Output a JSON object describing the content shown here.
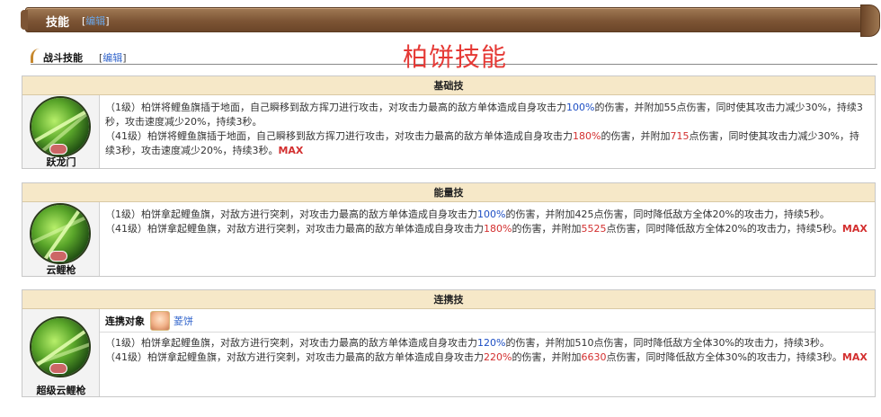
{
  "banner": {
    "title": "技能",
    "edit_open": "[",
    "edit_label": "编辑",
    "edit_close": "]"
  },
  "subhead": {
    "title": "战斗技能",
    "edit_open": "[",
    "edit_label": "编辑",
    "edit_close": "]"
  },
  "page_title": "柏饼技能",
  "skills": [
    {
      "section": "基础技",
      "name": "跃龙门",
      "level1": {
        "pre": "（1级）柏饼将鲤鱼旗插于地面，自己瞬移到敌方挥刀进行攻击，对攻击力最高的敌方单体造成自身攻击力",
        "pct": "100%",
        "mid": "的伤害，并附加55点伤害，同时使其攻击力减少30%，持续3秒，攻击速度减少20%，持续3秒。"
      },
      "level41": {
        "pre": "（41级）柏饼将鲤鱼旗插于地面，自己瞬移到敌方挥刀进行攻击，对攻击力最高的敌方单体造成自身攻击力",
        "pct": "180%",
        "mid": "的伤害，并附加",
        "num": "715",
        "post": "点伤害，同时使其攻击力减少30%，持续3秒，攻击速度减少20%，持续3秒。",
        "max": "MAX"
      }
    },
    {
      "section": "能量技",
      "name": "云鲤枪",
      "level1": {
        "pre": "（1级）柏饼拿起鲤鱼旗，对敌方进行突刺，对攻击力最高的敌方单体造成自身攻击力",
        "pct": "100%",
        "mid": "的伤害，并附加425点伤害，同时降低敌方全体20%的攻击力，持续5秒。"
      },
      "level41": {
        "pre": "（41级）柏饼拿起鲤鱼旗，对敌方进行突刺，对攻击力最高的敌方单体造成自身攻击力",
        "pct": "180%",
        "mid": "的伤害，并附加",
        "num": "5525",
        "post": "点伤害，同时降低敌方全体20%的攻击力，持续5秒。",
        "max": "MAX"
      }
    },
    {
      "section": "连携技",
      "name": "超级云鲤枪",
      "partner_label": "连携对象",
      "partner_name": "菱饼",
      "level1": {
        "pre": "（1级）柏饼拿起鲤鱼旗，对敌方进行突刺，对攻击力最高的敌方单体造成自身攻击力",
        "pct": "120%",
        "mid": "的伤害，并附加510点伤害，同时降低敌方全体30%的攻击力，持续3秒。"
      },
      "level41": {
        "pre": "（41级）柏饼拿起鲤鱼旗，对敌方进行突刺，对攻击力最高的敌方单体造成自身攻击力",
        "pct": "220%",
        "mid": "的伤害，并附加",
        "num": "6630",
        "post": "点伤害，同时降低敌方全体30%的攻击力，持续3秒。",
        "max": "MAX"
      }
    }
  ],
  "colors": {
    "banner": "#7d5535",
    "section_header": "#f6e8c8",
    "highlight_red": "#d32f2f",
    "highlight_blue": "#1e4fc4",
    "title_red": "#e53935"
  },
  "icons": [
    "dragon-gate-skill-icon",
    "cloud-carp-spear-skill-icon",
    "super-cloud-carp-spear-skill-icon",
    "partner-avatar"
  ]
}
